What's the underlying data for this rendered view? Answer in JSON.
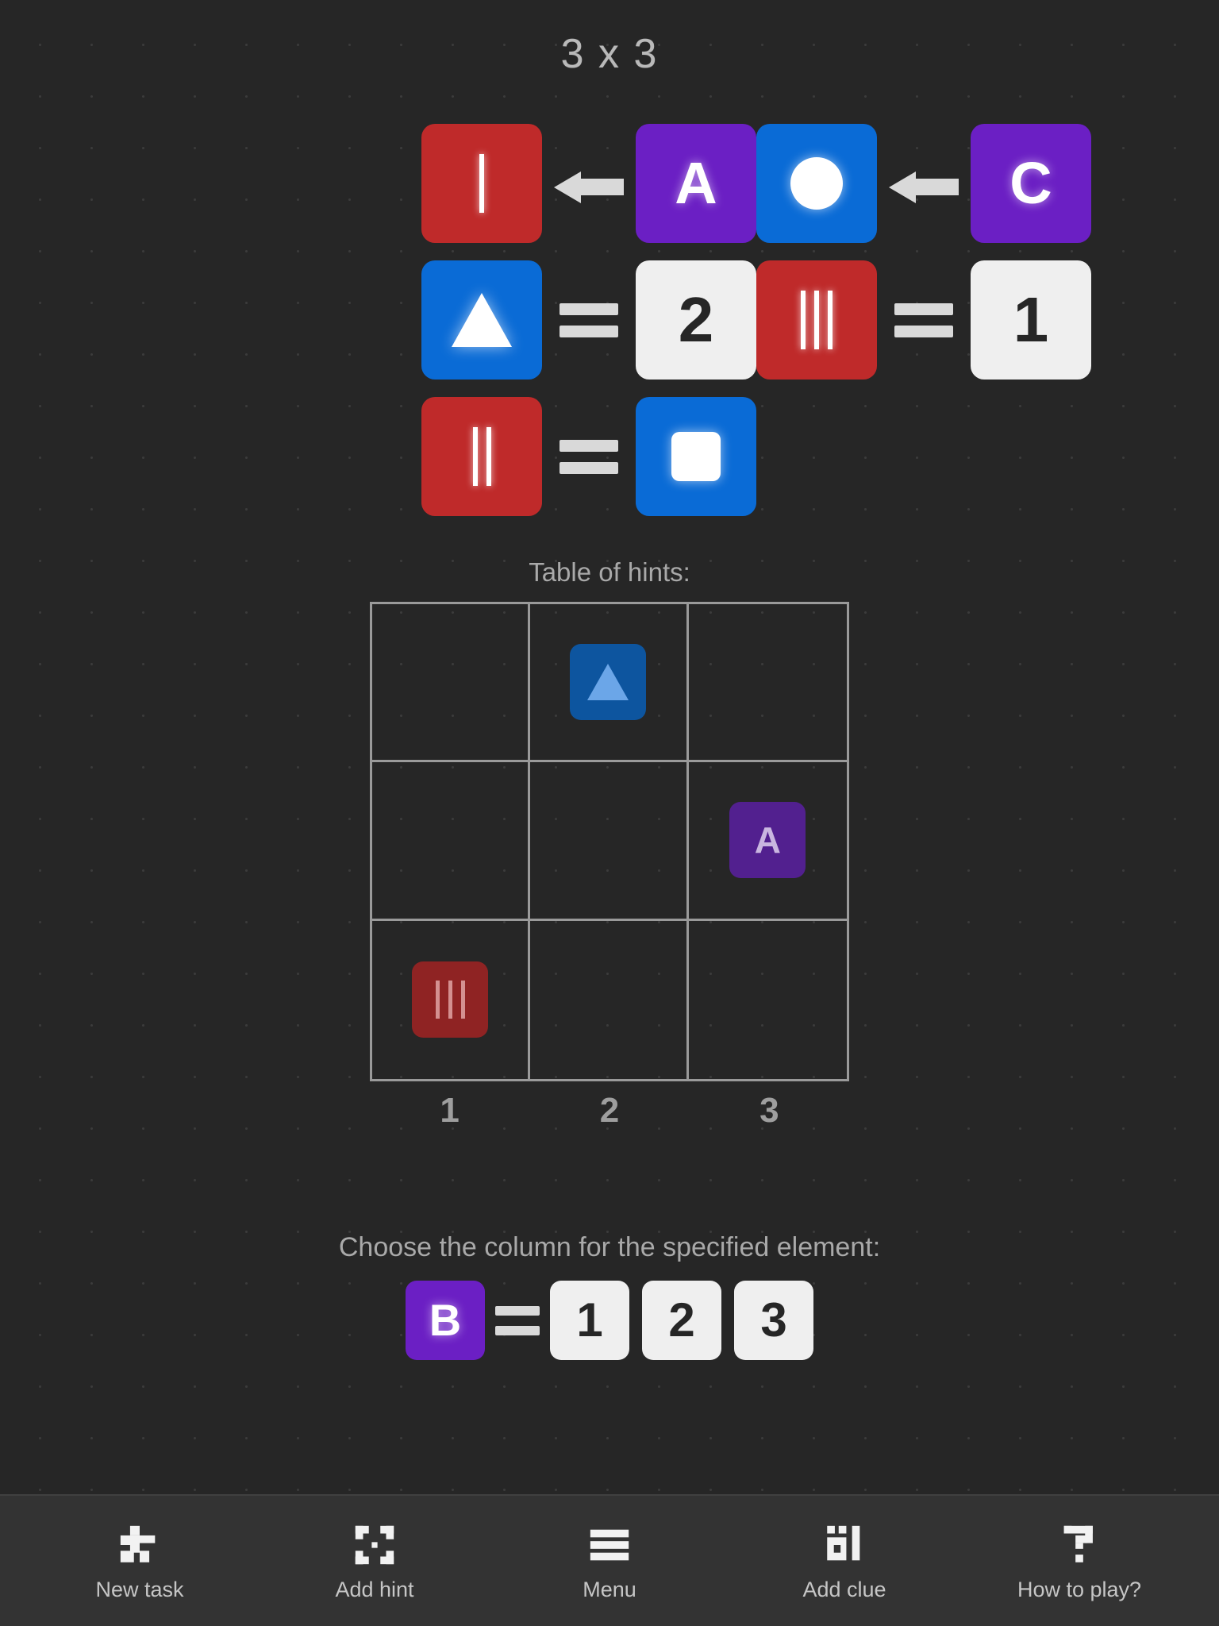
{
  "title": "3 x 3",
  "clues": {
    "rows": [
      {
        "pairs": [
          {
            "left": {
              "color": "red",
              "glyph": "tally-1"
            },
            "op": "arrow-left",
            "right": {
              "color": "purple",
              "glyph": "letter",
              "text": "A"
            }
          },
          {
            "left": {
              "color": "blue",
              "glyph": "circle"
            },
            "op": "arrow-left",
            "right": {
              "color": "purple",
              "glyph": "letter",
              "text": "C"
            }
          }
        ]
      },
      {
        "pairs": [
          {
            "left": {
              "color": "blue",
              "glyph": "triangle"
            },
            "op": "equals",
            "right": {
              "color": "white",
              "glyph": "letter",
              "text": "2"
            }
          },
          {
            "left": {
              "color": "red",
              "glyph": "tally-3"
            },
            "op": "equals",
            "right": {
              "color": "white",
              "glyph": "letter",
              "text": "1"
            }
          }
        ]
      },
      {
        "pairs": [
          {
            "left": {
              "color": "red",
              "glyph": "tally-2"
            },
            "op": "equals",
            "right": {
              "color": "blue",
              "glyph": "square"
            }
          }
        ]
      }
    ]
  },
  "hints": {
    "label": "Table of hints:",
    "cells": [
      {
        "row": 1,
        "col": 1,
        "empty": true
      },
      {
        "row": 1,
        "col": 2,
        "color": "blue",
        "glyph": "triangle"
      },
      {
        "row": 1,
        "col": 3,
        "empty": true
      },
      {
        "row": 2,
        "col": 1,
        "empty": true
      },
      {
        "row": 2,
        "col": 2,
        "empty": true
      },
      {
        "row": 2,
        "col": 3,
        "color": "purple",
        "glyph": "letter",
        "text": "A"
      },
      {
        "row": 3,
        "col": 1,
        "color": "red",
        "glyph": "tally-3"
      },
      {
        "row": 3,
        "col": 2,
        "empty": true
      },
      {
        "row": 3,
        "col": 3,
        "empty": true
      }
    ],
    "column_labels": [
      "1",
      "2",
      "3"
    ]
  },
  "question": {
    "prompt": "Choose the column for the specified element:",
    "subject": {
      "color": "purple",
      "text": "B"
    },
    "operator": "equals",
    "choices": [
      "1",
      "2",
      "3"
    ]
  },
  "toolbar": {
    "items": [
      {
        "label": "New task",
        "icon": "puzzle-blocks-icon"
      },
      {
        "label": "Add hint",
        "icon": "corner-brackets-icon"
      },
      {
        "label": "Menu",
        "icon": "hamburger-icon"
      },
      {
        "label": "Add clue",
        "icon": "blocks-icon"
      },
      {
        "label": "How to play?",
        "icon": "question-mark-icon"
      }
    ]
  },
  "colors": {
    "background": "#262626",
    "red": "#bf2a2a",
    "blue": "#0a6bd6",
    "purple": "#6b1fc4",
    "white_tile": "#efefef",
    "toolbar": "#333333",
    "grid_line": "#9a9a9a",
    "text_muted": "#a9a9a9"
  }
}
